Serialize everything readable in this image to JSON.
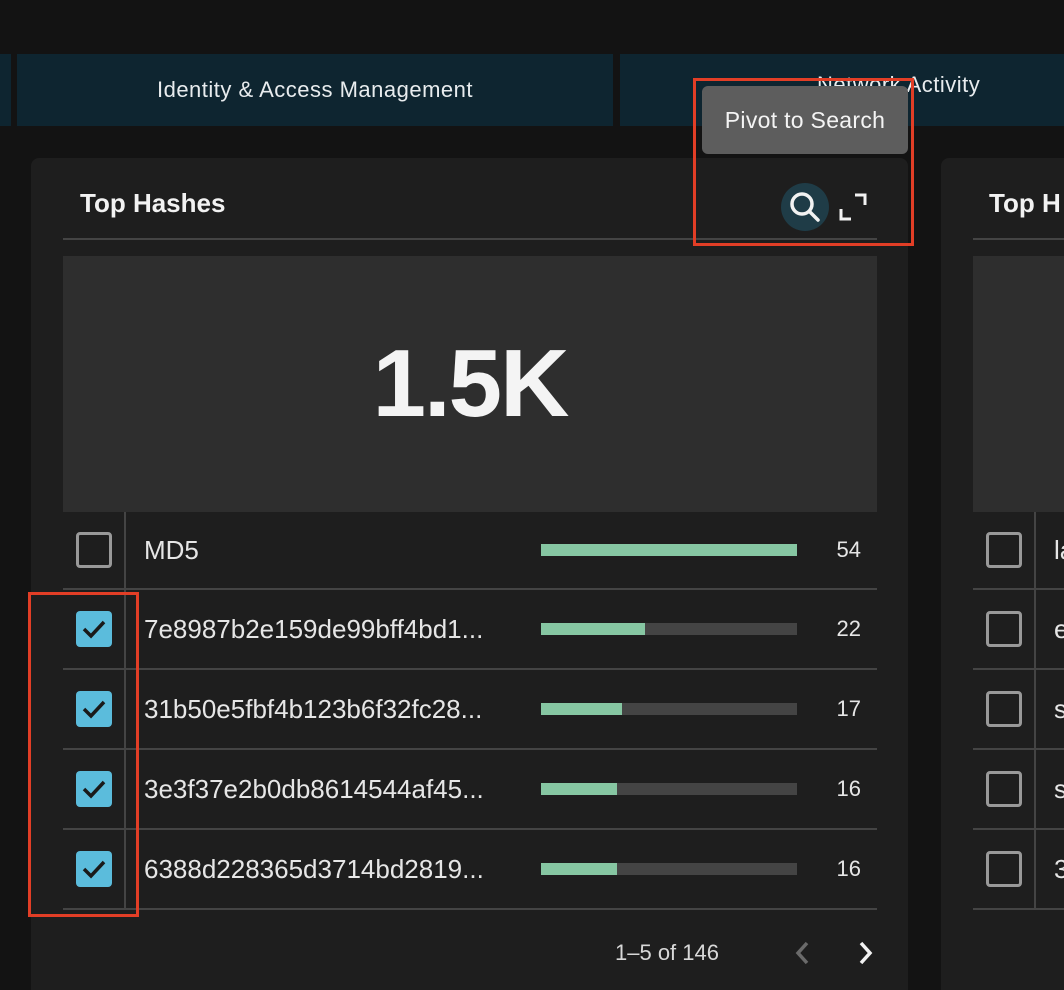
{
  "tabs": [
    {
      "label": ""
    },
    {
      "label": "Identity & Access Management"
    },
    {
      "label": "Network Activity"
    }
  ],
  "tooltip": {
    "text": "Pivot to Search"
  },
  "panels": [
    {
      "title": "Top Hashes",
      "actions": {
        "search_icon": "search-icon",
        "expand_icon": "expand-icon"
      },
      "big_number": "1.5K",
      "rows": [
        {
          "label": "MD5",
          "value": "54",
          "fraction": 1.0,
          "checked": false
        },
        {
          "label": "7e8987b2e159de99bff4bd1...",
          "value": "22",
          "fraction": 0.407,
          "checked": true
        },
        {
          "label": "31b50e5fbf4b123b6f32fc28...",
          "value": "17",
          "fraction": 0.315,
          "checked": true
        },
        {
          "label": "3e3f37e2b0db8614544af45...",
          "value": "16",
          "fraction": 0.296,
          "checked": true
        },
        {
          "label": "6388d228365d3714bd2819...",
          "value": "16",
          "fraction": 0.296,
          "checked": true
        }
      ],
      "pagination": {
        "text": "1–5 of 146",
        "prev_icon": "chevron-left-icon",
        "next_icon": "chevron-right-icon"
      }
    },
    {
      "title": "Top H",
      "rows": [
        {
          "label": "la",
          "checked": false
        },
        {
          "label": "e",
          "checked": false
        },
        {
          "label": "s",
          "checked": false
        },
        {
          "label": "s",
          "checked": false
        },
        {
          "label": "3",
          "checked": false
        }
      ]
    }
  ],
  "colors": {
    "accent_checkbox": "#5bbcdc",
    "bar_fill": "#86c6a2",
    "highlight": "#e23e26",
    "tab_bg": "#0e2530"
  }
}
